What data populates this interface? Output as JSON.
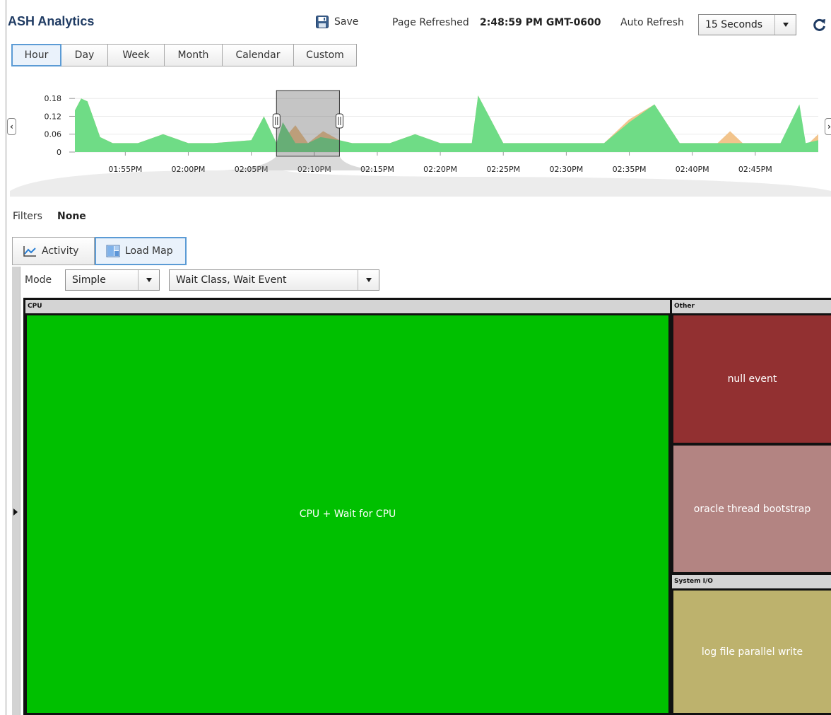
{
  "header": {
    "title": "ASH Analytics",
    "save_label": "Save",
    "page_refreshed_label": "Page Refreshed",
    "page_refreshed_value": "2:48:59 PM GMT-0600",
    "auto_refresh_label": "Auto Refresh",
    "auto_refresh_value": "15 Seconds"
  },
  "time_buttons": {
    "items": [
      {
        "label": "Hour",
        "active": true
      },
      {
        "label": "Day",
        "active": false
      },
      {
        "label": "Week",
        "active": false
      },
      {
        "label": "Month",
        "active": false
      },
      {
        "label": "Calendar",
        "active": false
      },
      {
        "label": "Custom",
        "active": false
      }
    ]
  },
  "chart_data": {
    "type": "area",
    "xlabel": "",
    "ylabel": "",
    "y_ticks": [
      "0.18",
      "0.12",
      "0.06",
      "0"
    ],
    "x_ticks": [
      "01:55PM",
      "02:00PM",
      "02:05PM",
      "02:10PM",
      "02:15PM",
      "02:20PM",
      "02:25PM",
      "02:30PM",
      "02:35PM",
      "02:40PM",
      "02:45PM"
    ],
    "ylim": [
      0,
      0.19
    ],
    "xlim_minutes": [
      0,
      59
    ],
    "grid": true,
    "series": [
      {
        "color": "#f2c48c",
        "x": [
          0,
          0.5,
          1,
          2,
          3,
          5,
          7,
          9,
          11,
          14,
          15,
          16,
          16.7,
          17.5,
          18.5,
          19.7,
          21,
          22,
          24.3,
          25,
          27,
          29,
          31,
          31.5,
          32,
          34,
          36,
          38,
          39,
          40,
          42,
          44,
          46,
          48,
          49,
          50,
          50.5,
          51,
          52,
          53,
          55,
          56,
          57.5,
          58,
          59
        ],
        "values": [
          0.14,
          0.18,
          0.17,
          0.05,
          0.03,
          0.03,
          0.06,
          0.03,
          0.03,
          0.04,
          0.12,
          0.03,
          0.05,
          0.09,
          0.03,
          0.07,
          0.04,
          0.03,
          0.03,
          0.03,
          0.06,
          0.03,
          0.03,
          0.03,
          0.19,
          0.03,
          0.03,
          0.03,
          0.03,
          0.03,
          0.03,
          0.11,
          0.16,
          0.03,
          0.03,
          0.03,
          0.03,
          0.03,
          0.07,
          0.03,
          0.03,
          0.03,
          0.03,
          0.02,
          0.06
        ]
      },
      {
        "color": "#6fdc86",
        "x": [
          0,
          0.5,
          1,
          2,
          3,
          5,
          7,
          9,
          11,
          14,
          15,
          16,
          16.5,
          17.5,
          18.5,
          19.5,
          21,
          22,
          24.3,
          25,
          27,
          29,
          31,
          31.5,
          32,
          34,
          36,
          38,
          39,
          40,
          42,
          44,
          46,
          48,
          49,
          50,
          50.5,
          51,
          52,
          53,
          55,
          56,
          57.5,
          58,
          59
        ],
        "values": [
          0.14,
          0.18,
          0.17,
          0.05,
          0.03,
          0.03,
          0.06,
          0.03,
          0.03,
          0.04,
          0.12,
          0.03,
          0.1,
          0.03,
          0.03,
          0.05,
          0.04,
          0.03,
          0.03,
          0.03,
          0.06,
          0.03,
          0.03,
          0.03,
          0.19,
          0.03,
          0.03,
          0.03,
          0.03,
          0.03,
          0.03,
          0.1,
          0.16,
          0.03,
          0.03,
          0.03,
          0.03,
          0.03,
          0.03,
          0.03,
          0.03,
          0.03,
          0.16,
          0.03,
          0.04
        ]
      }
    ],
    "selection_minutes": [
      16,
      21
    ]
  },
  "filters": {
    "label": "Filters",
    "value": "None"
  },
  "view_tabs": {
    "activity_label": "Activity",
    "load_map_label": "Load Map"
  },
  "load_map": {
    "mode_label": "Mode",
    "mode_value": "Simple",
    "dimension_value": "Wait Class, Wait Event",
    "colors": {
      "cpu": "#00c000",
      "null_event": "#923031",
      "bootstrap": "#b38482",
      "log_file": "#bdb26d"
    },
    "groups": {
      "cpu": "CPU",
      "other": "Other",
      "system_io": "System I/O"
    },
    "cells": {
      "cpu_wait": "CPU + Wait for CPU",
      "null_event": "null event",
      "bootstrap": "oracle thread bootstrap",
      "log_file": "log file parallel write"
    }
  }
}
